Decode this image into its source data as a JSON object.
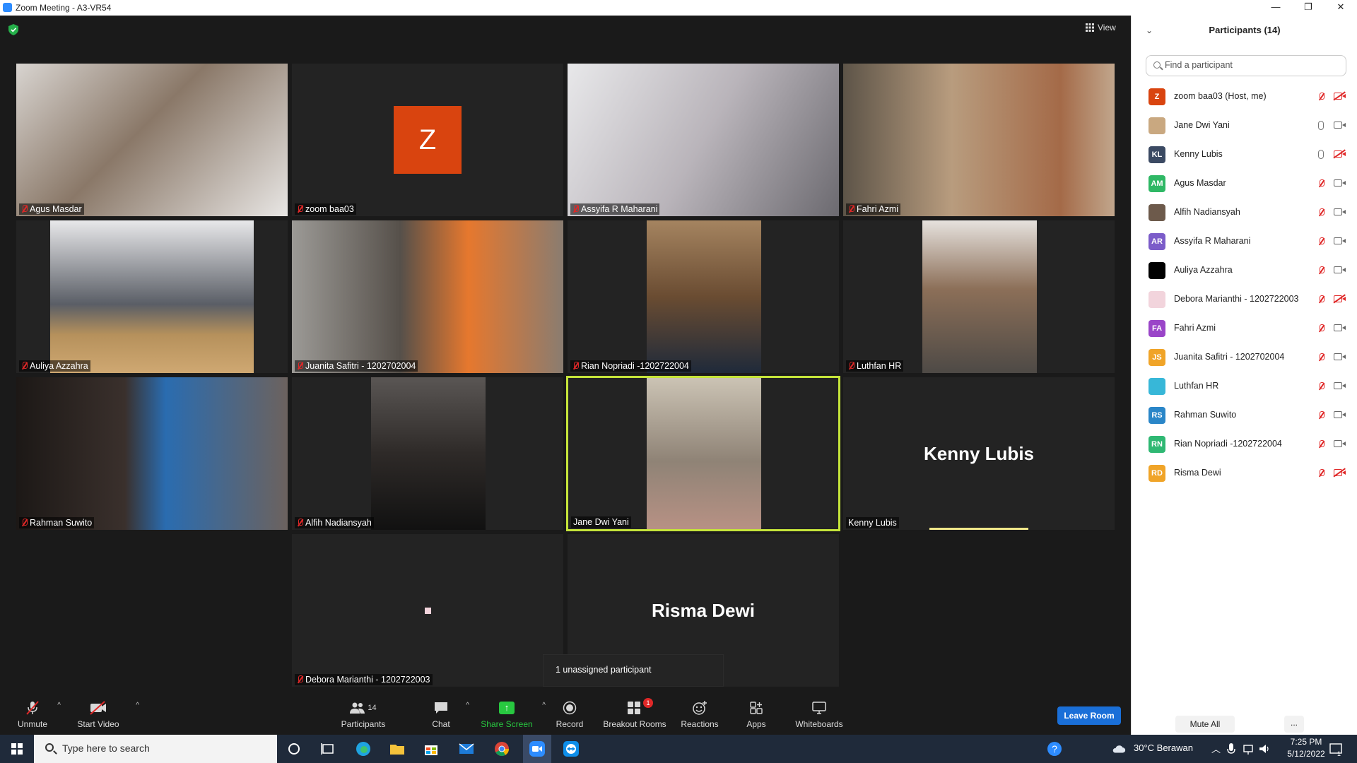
{
  "window": {
    "title": "Zoom Meeting - A3-VR54",
    "min": "—",
    "restore": "❐",
    "close": "✕"
  },
  "view_label": "View",
  "tiles": [
    {
      "name": "Agus Masdar",
      "muted": true,
      "kind": "video",
      "vbg": "#9a8c80"
    },
    {
      "name": "zoom baa03",
      "muted": true,
      "kind": "avatar",
      "avatar_letter": "Z",
      "avatar_color": "#d9440f"
    },
    {
      "name": "Assyifa R Maharani",
      "muted": true,
      "kind": "video",
      "vbg": "#b8b6b8"
    },
    {
      "name": "Fahri Azmi",
      "muted": true,
      "kind": "video",
      "vbg": "#8d7d6c"
    },
    {
      "name": "Auliya Azzahra",
      "muted": true,
      "kind": "video_narrow",
      "vbg": "#777a80"
    },
    {
      "name": "Juanita Safitri - 1202702004",
      "muted": true,
      "kind": "video",
      "vbg": "#7c7470"
    },
    {
      "name": "Rian Nopriadi -1202722004",
      "muted": true,
      "kind": "video_narrow",
      "vbg": "#5a4637"
    },
    {
      "name": "Luthfan HR",
      "muted": true,
      "kind": "video_narrow",
      "vbg": "#6a635c"
    },
    {
      "name": "Rahman Suwito",
      "muted": true,
      "kind": "video",
      "vbg": "#2c2624"
    },
    {
      "name": "Alfih Nadiansyah",
      "muted": true,
      "kind": "video_narrow",
      "vbg": "#3a3634"
    },
    {
      "name": "Jane Dwi Yani",
      "muted": false,
      "kind": "video_narrow",
      "vbg": "#8f8376"
    },
    {
      "name": "Kenny Lubis",
      "muted": false,
      "kind": "name",
      "display": "Kenny Lubis"
    },
    {
      "name": "Debora Marianthi - 1202722003",
      "muted": true,
      "kind": "dot"
    },
    {
      "name": "",
      "muted": false,
      "kind": "name",
      "display": "Risma Dewi"
    }
  ],
  "toast": "1 unassigned participant",
  "toolbar": {
    "unmute": "Unmute",
    "start_video": "Start Video",
    "participants": "Participants",
    "participants_count": "14",
    "chat": "Chat",
    "share_screen": "Share Screen",
    "record": "Record",
    "breakout_rooms": "Breakout Rooms",
    "breakout_badge": "1",
    "reactions": "Reactions",
    "apps": "Apps",
    "whiteboards": "Whiteboards",
    "leave_room": "Leave Room"
  },
  "panel": {
    "title": "Participants (14)",
    "search_placeholder": "Find a participant",
    "mute_all": "Mute All",
    "more": "...",
    "participants": [
      {
        "name": "zoom baa03 (Host, me)",
        "initials": "Z",
        "color": "#d9440f",
        "mic": "off",
        "cam": "off"
      },
      {
        "name": "Jane Dwi Yani",
        "initials": "",
        "color": "#c9a880",
        "mic": "on",
        "cam": "on"
      },
      {
        "name": "Kenny Lubis",
        "initials": "KL",
        "color": "#3b4a63",
        "mic": "on",
        "cam": "off"
      },
      {
        "name": "Agus Masdar",
        "initials": "AM",
        "color": "#2fb865",
        "mic": "off",
        "cam": "on"
      },
      {
        "name": "Alfih Nadiansyah",
        "initials": "",
        "color": "#6d5a4b",
        "mic": "off",
        "cam": "on"
      },
      {
        "name": "Assyifa R Maharani",
        "initials": "AR",
        "color": "#7b5cc9",
        "mic": "off",
        "cam": "on"
      },
      {
        "name": "Auliya Azzahra",
        "initials": "",
        "color": "#000000",
        "mic": "off",
        "cam": "on"
      },
      {
        "name": "Debora Marianthi - 1202722003",
        "initials": "",
        "color": "#f2d4dc",
        "mic": "off",
        "cam": "off"
      },
      {
        "name": "Fahri Azmi",
        "initials": "FA",
        "color": "#9a45c8",
        "mic": "off",
        "cam": "on"
      },
      {
        "name": "Juanita Safitri - 1202702004",
        "initials": "JS",
        "color": "#f0a428",
        "mic": "off",
        "cam": "on"
      },
      {
        "name": "Luthfan HR",
        "initials": "",
        "color": "#37b7d8",
        "mic": "off",
        "cam": "on"
      },
      {
        "name": "Rahman Suwito",
        "initials": "RS",
        "color": "#2a86c8",
        "mic": "off",
        "cam": "on"
      },
      {
        "name": "Rian Nopriadi -1202722004",
        "initials": "RN",
        "color": "#2fb873",
        "mic": "off",
        "cam": "on"
      },
      {
        "name": "Risma Dewi",
        "initials": "RD",
        "color": "#f0a428",
        "mic": "off",
        "cam": "off"
      }
    ]
  },
  "taskbar": {
    "search_placeholder": "Type here to search",
    "weather": "30°C  Berawan",
    "time": "7:25 PM",
    "date": "5/12/2022",
    "notif_count": "1"
  }
}
